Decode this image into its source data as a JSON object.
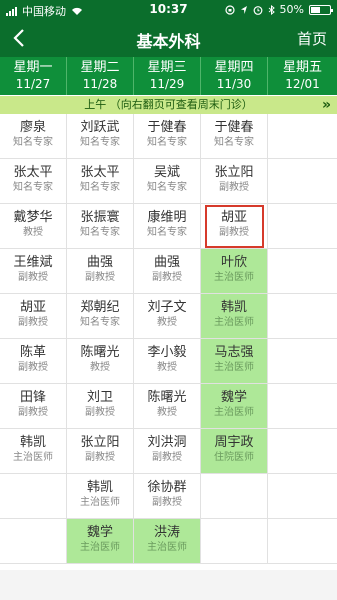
{
  "status": {
    "carrier": "中国移动",
    "time": "10:37",
    "battery": "50%",
    "battery_level": 0.5
  },
  "nav": {
    "title": "基本外科",
    "home": "首页"
  },
  "days": [
    {
      "name": "星期一",
      "date": "11/27"
    },
    {
      "name": "星期二",
      "date": "11/28"
    },
    {
      "name": "星期三",
      "date": "11/29"
    },
    {
      "name": "星期四",
      "date": "11/30"
    },
    {
      "name": "星期五",
      "date": "12/01"
    }
  ],
  "banner": "上午 （向右翻页可查看周末门诊）",
  "columns": [
    [
      {
        "name": "廖泉",
        "title": "知名专家"
      },
      {
        "name": "张太平",
        "title": "知名专家"
      },
      {
        "name": "戴梦华",
        "title": "教授"
      },
      {
        "name": "王维斌",
        "title": "副教授"
      },
      {
        "name": "胡亚",
        "title": "副教授"
      },
      {
        "name": "陈革",
        "title": "副教授"
      },
      {
        "name": "田锋",
        "title": "副教授"
      },
      {
        "name": "韩凯",
        "title": "主治医师"
      },
      {
        "name": "",
        "title": ""
      },
      {
        "name": "",
        "title": ""
      }
    ],
    [
      {
        "name": "刘跃武",
        "title": "知名专家"
      },
      {
        "name": "张太平",
        "title": "知名专家"
      },
      {
        "name": "张振寰",
        "title": "知名专家"
      },
      {
        "name": "曲强",
        "title": "副教授"
      },
      {
        "name": "郑朝纪",
        "title": "知名专家"
      },
      {
        "name": "陈曙光",
        "title": "教授"
      },
      {
        "name": "刘卫",
        "title": "副教授"
      },
      {
        "name": "张立阳",
        "title": "副教授"
      },
      {
        "name": "韩凯",
        "title": "主治医师"
      },
      {
        "name": "魏学",
        "title": "主治医师"
      }
    ],
    [
      {
        "name": "于健春",
        "title": "知名专家"
      },
      {
        "name": "吴斌",
        "title": "知名专家"
      },
      {
        "name": "康维明",
        "title": "知名专家"
      },
      {
        "name": "曲强",
        "title": "副教授"
      },
      {
        "name": "刘子文",
        "title": "教授"
      },
      {
        "name": "李小毅",
        "title": "教授"
      },
      {
        "name": "陈曙光",
        "title": "教授"
      },
      {
        "name": "刘洪洞",
        "title": "副教授"
      },
      {
        "name": "徐协群",
        "title": "副教授"
      },
      {
        "name": "洪涛",
        "title": "主治医师"
      }
    ],
    [
      {
        "name": "于健春",
        "title": "知名专家"
      },
      {
        "name": "张立阳",
        "title": "副教授"
      },
      {
        "name": "胡亚",
        "title": "副教授"
      },
      {
        "name": "叶欣",
        "title": "主治医师"
      },
      {
        "name": "韩凯",
        "title": "主治医师"
      },
      {
        "name": "马志强",
        "title": "主治医师"
      },
      {
        "name": "魏学",
        "title": "主治医师"
      },
      {
        "name": "周宇政",
        "title": "住院医师"
      },
      {
        "name": "",
        "title": ""
      },
      {
        "name": "",
        "title": ""
      }
    ]
  ],
  "green_cells": [
    "1-9",
    "2-9",
    "3-3",
    "3-4",
    "3-5",
    "3-6",
    "3-7"
  ],
  "selected_cell": "3-2",
  "page_dots": {
    "count": 2,
    "active": 0
  },
  "colors": {
    "header": "#0b6e2c",
    "day_bar": "#0f8f3a",
    "banner": "#c9e88a",
    "available": "#aee898",
    "selected_border": "#d63a2b"
  }
}
